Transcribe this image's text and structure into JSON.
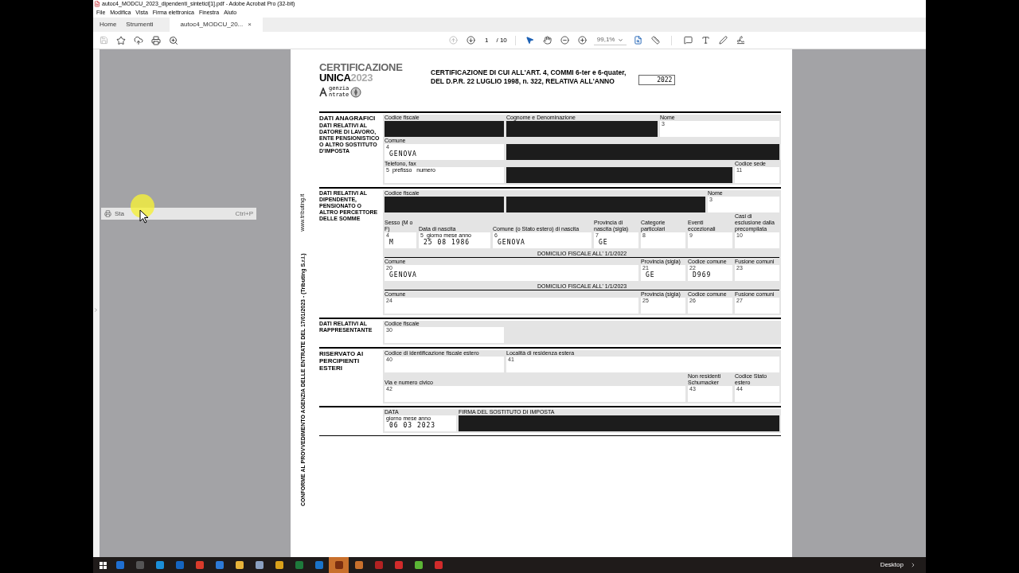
{
  "window": {
    "title": "autoc4_MODCU_2023_dipendenti_sintetici[1].pdf - Adobe Acrobat Pro (32-bit)"
  },
  "menu": [
    "File",
    "Modifica",
    "Vista",
    "Firma elettronica",
    "Finestra",
    "Aiuto"
  ],
  "tabs": [
    {
      "label": "Home",
      "selected": false
    },
    {
      "label": "Strumenti",
      "selected": false
    },
    {
      "label": "autoc4_MODCU_20...",
      "selected": true,
      "close": "×"
    }
  ],
  "page_nav": {
    "current": "1",
    "total": "/ 10"
  },
  "zoom": "99,1%",
  "context_menu": {
    "label": "Sta",
    "shortcut": "Ctrl+P"
  },
  "document": {
    "logo": {
      "line1": "CERTIFICAZIONE",
      "line2a": "UNICA",
      "line2b": "2023",
      "agency1": "genzia",
      "agency2": "ntrate"
    },
    "heading": [
      "CERTIFICAZIONE DI CUI ALL'ART. 4, COMMI 6-ter e 6-quater,",
      "DEL D.P.R. 22 LUGLIO 1998, n. 322, RELATIVA ALL'ANNO"
    ],
    "year": "2022",
    "side_text": "CONFORME AL PROVVEDIMENTO AGENZIA DELLE ENTRATE DEL 17/01/2023 - (Tributing S.r.l.)",
    "side_url": "www.tributing.it",
    "sections": [
      {
        "title": "DATI ANAGRAFICI",
        "subtitle": "DATI RELATIVI AL DATORE DI LAVORO, ENTE PENSIONISTICO O ALTRO SOSTITUTO D'IMPOSTA",
        "rows": [
          {
            "kind": "fields",
            "fields": [
              {
                "label": "Codice fiscale",
                "kind": "long",
                "redacted": true
              },
              {
                "label": "Cognome e Denominazione",
                "kind": "wide",
                "redacted": true
              },
              {
                "label": "Nome",
                "number": "3",
                "kind": "long",
                "redacted": false
              }
            ]
          },
          {
            "kind": "fields",
            "fields": [
              {
                "label": "Comune",
                "number": "4",
                "value": "GENOVA",
                "kind": "long",
                "redacted": false
              },
              {
                "kind": "wide",
                "redacted": true
              }
            ]
          },
          {
            "kind": "fields",
            "fields": [
              {
                "label": "Telefono, fax",
                "number": "5",
                "sub": "prefisso   numero",
                "kind": "long",
                "redacted": false
              },
              {
                "kind": "wide",
                "redacted": true
              },
              {
                "label": "Codice sede",
                "number": "11",
                "kind": "short",
                "redacted": false
              }
            ]
          }
        ]
      },
      {
        "subtitle": "DATI RELATIVI AL DIPENDENTE, PENSIONATO O ALTRO PERCETTORE DELLE SOMME",
        "rows": [
          {
            "kind": "fields",
            "fields": [
              {
                "label": "Codice fiscale",
                "kind": "long",
                "redacted": true
              },
              {
                "kind": "wide",
                "redacted": true
              },
              {
                "label": "Nome",
                "number": "3",
                "kind": "medium",
                "redacted": false
              }
            ]
          },
          {
            "kind": "fields",
            "fields": [
              {
                "label": "Sesso (M o F)",
                "number": "4",
                "value": "M",
                "kind": "tiny",
                "redacted": false
              },
              {
                "label": "Data di nascita",
                "number": "5",
                "sub": "giorno mese anno",
                "value": "25 08 1986",
                "kind": "medium",
                "redacted": false
              },
              {
                "label": "Comune (o Stato estero) di nascita",
                "number": "6",
                "value": "GENOVA",
                "kind": "wide",
                "redacted": false
              },
              {
                "label": "Provincia di nascita (sigla)",
                "number": "7",
                "value": "GE",
                "kind": "short",
                "redacted": false
              },
              {
                "label": "Categorie particolari",
                "number": "8",
                "kind": "short",
                "redacted": false
              },
              {
                "label": "Eventi eccezionali",
                "number": "9",
                "kind": "short",
                "redacted": false
              },
              {
                "label": "Casi di esclusione dalla precompilata",
                "number": "10",
                "kind": "short",
                "redacted": false
              }
            ]
          },
          {
            "kind": "heading",
            "text": "DOMICILIO FISCALE ALL' 1/1/2022"
          },
          {
            "kind": "fields",
            "fields": [
              {
                "label": "Comune",
                "number": "20",
                "value": "GENOVA",
                "kind": "wide",
                "redacted": false
              },
              {
                "label": "Provincia (sigla)",
                "number": "21",
                "value": "GE",
                "kind": "short",
                "redacted": false
              },
              {
                "label": "Codice comune",
                "number": "22",
                "value": "D969",
                "kind": "short",
                "redacted": false
              },
              {
                "label": "Fusione comuni",
                "number": "23",
                "kind": "short",
                "redacted": false
              }
            ]
          },
          {
            "kind": "heading",
            "text": "DOMICILIO FISCALE ALL' 1/1/2023"
          },
          {
            "kind": "fields",
            "fields": [
              {
                "label": "Comune",
                "number": "24",
                "kind": "wide",
                "redacted": false
              },
              {
                "label": "Provincia (sigla)",
                "number": "25",
                "kind": "short",
                "redacted": false
              },
              {
                "label": "Codice comune",
                "number": "26",
                "kind": "short",
                "redacted": false
              },
              {
                "label": "Fusione comuni",
                "number": "27",
                "kind": "short",
                "redacted": false
              }
            ]
          }
        ]
      },
      {
        "subtitle": "DATI RELATIVI AL RAPPRESENTANTE",
        "rows": [
          {
            "kind": "fields",
            "fields": [
              {
                "label": "Codice fiscale",
                "number": "30",
                "kind": "long",
                "redacted": false
              }
            ]
          }
        ]
      },
      {
        "title": "RISERVATO AI PERCIPIENTI ESTERI",
        "rows": [
          {
            "kind": "fields",
            "fields": [
              {
                "label": "Codice di identificazione fiscale estero",
                "number": "40",
                "kind": "long",
                "redacted": false
              },
              {
                "label": "Località di residenza estera",
                "number": "41",
                "kind": "wide",
                "redacted": false
              }
            ]
          },
          {
            "kind": "fields",
            "fields": [
              {
                "label": "Via e numero civico",
                "number": "42",
                "kind": "wide",
                "redacted": false
              },
              {
                "label": "Non residenti Schumacker",
                "number": "43",
                "kind": "short",
                "redacted": false
              },
              {
                "label": "Codice Stato estero",
                "number": "44",
                "kind": "short",
                "redacted": false
              }
            ]
          }
        ]
      },
      {
        "rows": [
          {
            "kind": "fields",
            "fields": [
              {
                "label": "DATA",
                "sub": "giorno mese anno",
                "value": "06 03 2023",
                "kind": "medium",
                "redacted": false
              },
              {
                "label": "FIRMA DEL SOSTITUTO DI IMPOSTA",
                "kind": "wide",
                "redacted": true
              }
            ]
          }
        ]
      }
    ]
  },
  "taskbar": {
    "apps": [
      {
        "selected": false
      },
      {
        "selected": false
      },
      {
        "selected": false
      },
      {
        "selected": false
      },
      {
        "selected": false
      },
      {
        "selected": false
      },
      {
        "selected": false
      },
      {
        "selected": false
      },
      {
        "selected": false
      },
      {
        "selected": false
      },
      {
        "selected": false
      },
      {
        "selected": true
      },
      {
        "selected": false
      },
      {
        "selected": false
      },
      {
        "selected": false
      },
      {
        "selected": false
      },
      {
        "selected": false
      }
    ],
    "desktop": "Desktop"
  }
}
